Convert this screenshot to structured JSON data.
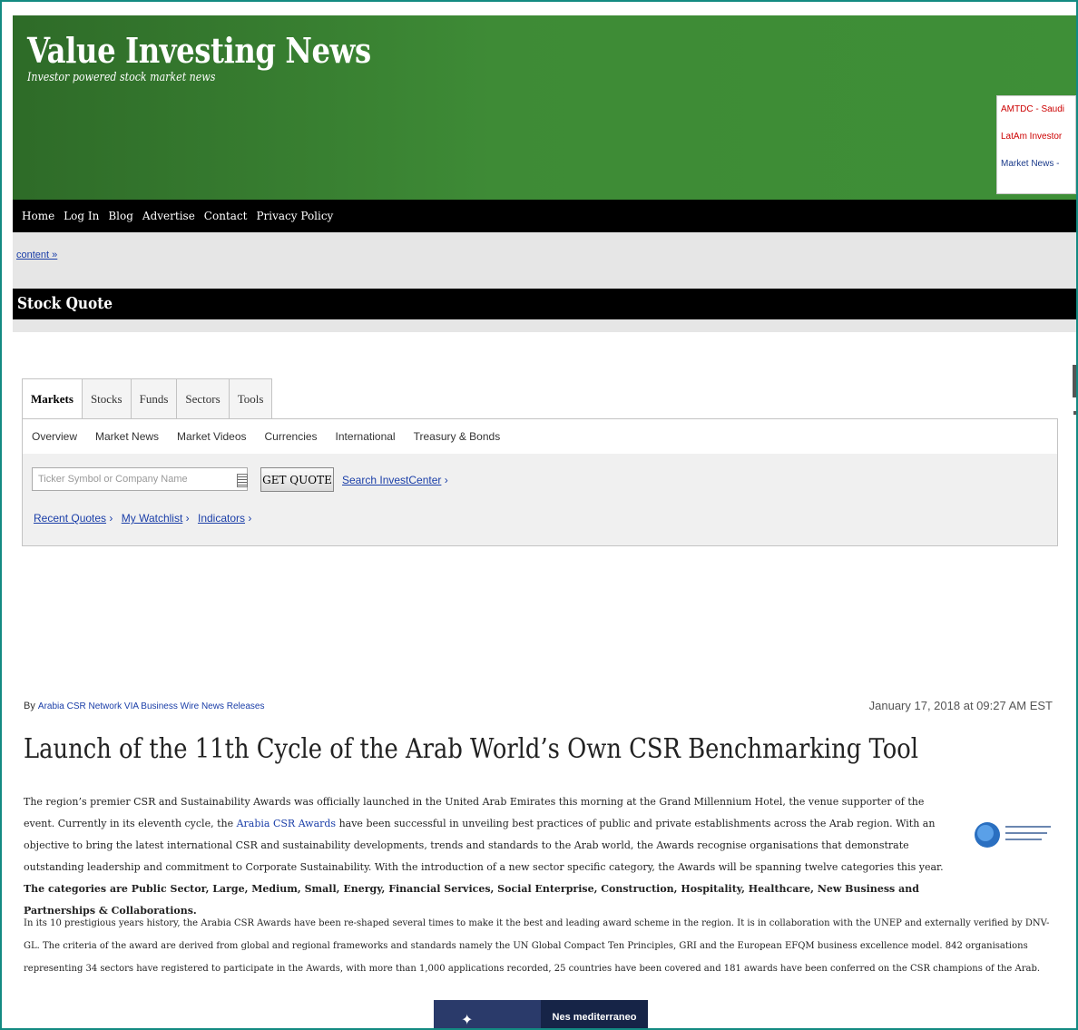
{
  "site": {
    "title": "Value Investing News",
    "tagline": "Investor powered stock market news"
  },
  "ticker_items": [
    "AMTDC - Saudi",
    "LatAm Investor",
    "Market News - "
  ],
  "nav": [
    "Home",
    "Log In",
    "Blog",
    "Advertise",
    "Contact",
    "Privacy Policy"
  ],
  "breadcrumb": "content »",
  "section_title": "Stock Quote",
  "quote_widget": {
    "tabs": [
      "Markets",
      "Stocks",
      "Funds",
      "Sectors",
      "Tools"
    ],
    "subtabs": [
      "Overview",
      "Market News",
      "Market Videos",
      "Currencies",
      "International",
      "Treasury & Bonds"
    ],
    "input_placeholder": "Ticker Symbol or Company Name",
    "button_label": "GET QUOTE",
    "search_link": "Search InvestCenter",
    "quick_links": [
      "Recent Quotes",
      "My Watchlist",
      "Indicators"
    ]
  },
  "article": {
    "byline_prefix": "By",
    "author": "Arabia CSR Network VIA Business Wire News Releases",
    "date": "January 17, 2018 at 09:27 AM EST",
    "headline": "Launch of the 11th Cycle of the Arab World’s Own CSR Benchmarking Tool",
    "para1_a": "The region’s premier CSR and Sustainability Awards was officially launched in the United Arab Emirates this morning at the Grand Millennium Hotel, the venue supporter of the event. Currently in its eleventh cycle, the ",
    "para1_link": "Arabia CSR Awards",
    "para1_b": " have been successful in unveiling best practices of public and private establishments across the Arab region. With an objective to bring the latest international CSR and sustainability developments, trends and standards to the Arab world, the Awards recognise organisations that demonstrate outstanding leadership and commitment to Corporate Sustainability. With the introduction of a new sector specific category, the Awards will be spanning twelve categories this year. ",
    "para1_bold": "The categories are Public Sector, Large, Medium, Small, Energy, Financial Services, Social Enterprise, Construction, Hospitality, Healthcare, New Business and Partnerships & Collaborations.",
    "para2": "In its 10 prestigious years history, the Arabia CSR Awards have been re-shaped several times to make it the best and leading award scheme in the region. It is in collaboration with the UNEP and externally verified by DNV-GL. The criteria of the award are derived from global and regional frameworks and standards namely the UN Global Compact Ten Principles, GRI and the European EFQM business excellence model. 842 organisations representing 34 sectors have registered to participate in the Awards, with more than 1,000 applications recorded, 25 countries have been covered and 181 awards have been conferred on the CSR champions of the Arab."
  },
  "banner_text": "Nes mediterraneo",
  "colors": {
    "header_green": "#3e8b36",
    "link_blue": "#1a3ea8",
    "frame_teal": "#138a82"
  }
}
